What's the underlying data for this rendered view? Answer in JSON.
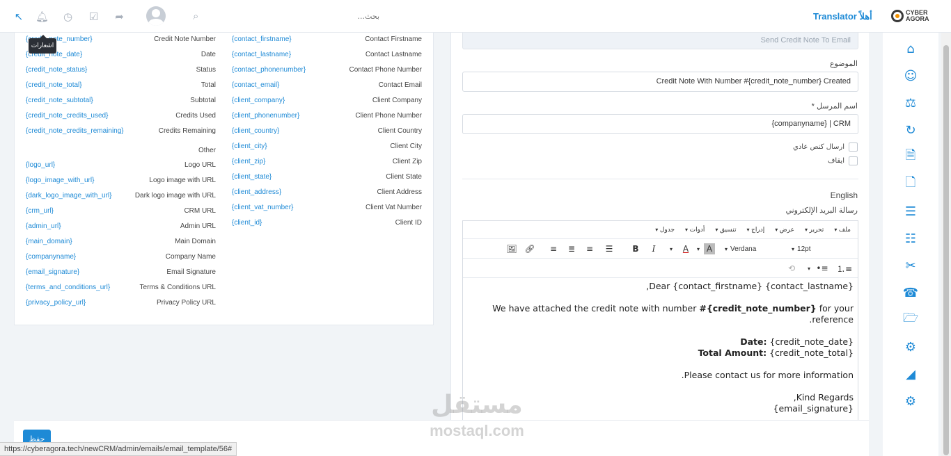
{
  "topbar": {
    "search_placeholder": "بحث...",
    "brand_title": "Translator أهلاً",
    "logo_line1": "CYBER",
    "logo_line2": "AGORA",
    "tooltip": "اشعارات",
    "icons": [
      "pin-icon",
      "bell-icon",
      "clock-icon",
      "checkbox-icon",
      "share-icon",
      "avatar",
      "search-icon"
    ]
  },
  "merge_fields": {
    "col1": [
      {
        "key": "{credit_note_number}",
        "label": "Credit Note Number"
      },
      {
        "key": "{credit_note_date}",
        "label": "Date"
      },
      {
        "key": "{credit_note_status}",
        "label": "Status"
      },
      {
        "key": "{credit_note_total}",
        "label": "Total"
      },
      {
        "key": "{credit_note_subtotal}",
        "label": "Subtotal"
      },
      {
        "key": "{credit_note_credits_used}",
        "label": "Credits Used"
      },
      {
        "key": "{credit_note_credits_remaining}",
        "label": "Credits Remaining"
      },
      {
        "key": "",
        "label": "Other"
      },
      {
        "key": "{logo_url}",
        "label": "Logo URL"
      },
      {
        "key": "{logo_image_with_url}",
        "label": "Logo image with URL"
      },
      {
        "key": "{dark_logo_image_with_url}",
        "label": "Dark logo image with URL"
      },
      {
        "key": "{crm_url}",
        "label": "CRM URL"
      },
      {
        "key": "{admin_url}",
        "label": "Admin URL"
      },
      {
        "key": "{main_domain}",
        "label": "Main Domain"
      },
      {
        "key": "{companyname}",
        "label": "Company Name"
      },
      {
        "key": "{email_signature}",
        "label": "Email Signature"
      },
      {
        "key": "{terms_and_conditions_url}",
        "label": "Terms & Conditions URL"
      },
      {
        "key": "{privacy_policy_url}",
        "label": "Privacy Policy URL"
      }
    ],
    "col2": [
      {
        "key": "{contact_firstname}",
        "label": "Contact Firstname"
      },
      {
        "key": "{contact_lastname}",
        "label": "Contact Lastname"
      },
      {
        "key": "{contact_phonenumber}",
        "label": "Contact Phone Number"
      },
      {
        "key": "{contact_email}",
        "label": "Contact Email"
      },
      {
        "key": "{client_company}",
        "label": "Client Company"
      },
      {
        "key": "{client_phonenumber}",
        "label": "Client Phone Number"
      },
      {
        "key": "{client_country}",
        "label": "Client Country"
      },
      {
        "key": "{client_city}",
        "label": "Client City"
      },
      {
        "key": "{client_zip}",
        "label": "Client Zip"
      },
      {
        "key": "{client_state}",
        "label": "Client State"
      },
      {
        "key": "{client_address}",
        "label": "Client Address"
      },
      {
        "key": "{client_vat_number}",
        "label": "Client Vat Number"
      },
      {
        "key": "{client_id}",
        "label": "Client ID"
      }
    ]
  },
  "form": {
    "template_name": "Send Credit Note To Email",
    "subject_label": "الموضوع",
    "subject_value": "Credit Note With Number #{credit_note_number} Created",
    "from_label": "* اسم المرسل",
    "from_value": "{companyname} | CRM",
    "plaintext_label": "ارسال كنص عادي",
    "disable_label": "ايقاف",
    "language": "English",
    "message_label": "رسالة البريد الإلكتروني"
  },
  "editor": {
    "menus": [
      "ملف",
      "تحرير",
      "عرض",
      "إدراج",
      "تنسيق",
      "أدوات",
      "جدول"
    ],
    "font_family": "Verdana",
    "font_size": "12pt",
    "body": {
      "greeting": "Dear {contact_firstname} {contact_lastname},",
      "line1_a": "We have attached the credit note with number",
      "line1_b": "#{credit_note_number}",
      "line1_c": "for your reference.",
      "date_label": "Date:",
      "date_value": "{credit_note_date}",
      "total_label": "Total Amount:",
      "total_value": "{credit_note_total}",
      "contact": "Please contact us for more information.",
      "regards": "Kind Regards,",
      "signature": "{email_signature}"
    }
  },
  "footer": {
    "save_label": "حفظ",
    "status_url": "https://cyberagora.tech/newCRM/admin/emails/email_template/56#"
  },
  "watermark": {
    "ar": "مستقل",
    "en": "mostaql.com"
  },
  "sidebar_icons": [
    "home-icon",
    "user-icon",
    "balance-scale-icon",
    "refresh-icon",
    "document-icon",
    "file-icon",
    "list-icon",
    "server-icon",
    "ticket-icon",
    "phone-icon",
    "folder-icon",
    "gears-icon",
    "chart-icon",
    "settings-icon"
  ],
  "colors": {
    "accent": "#1e8ad6"
  }
}
